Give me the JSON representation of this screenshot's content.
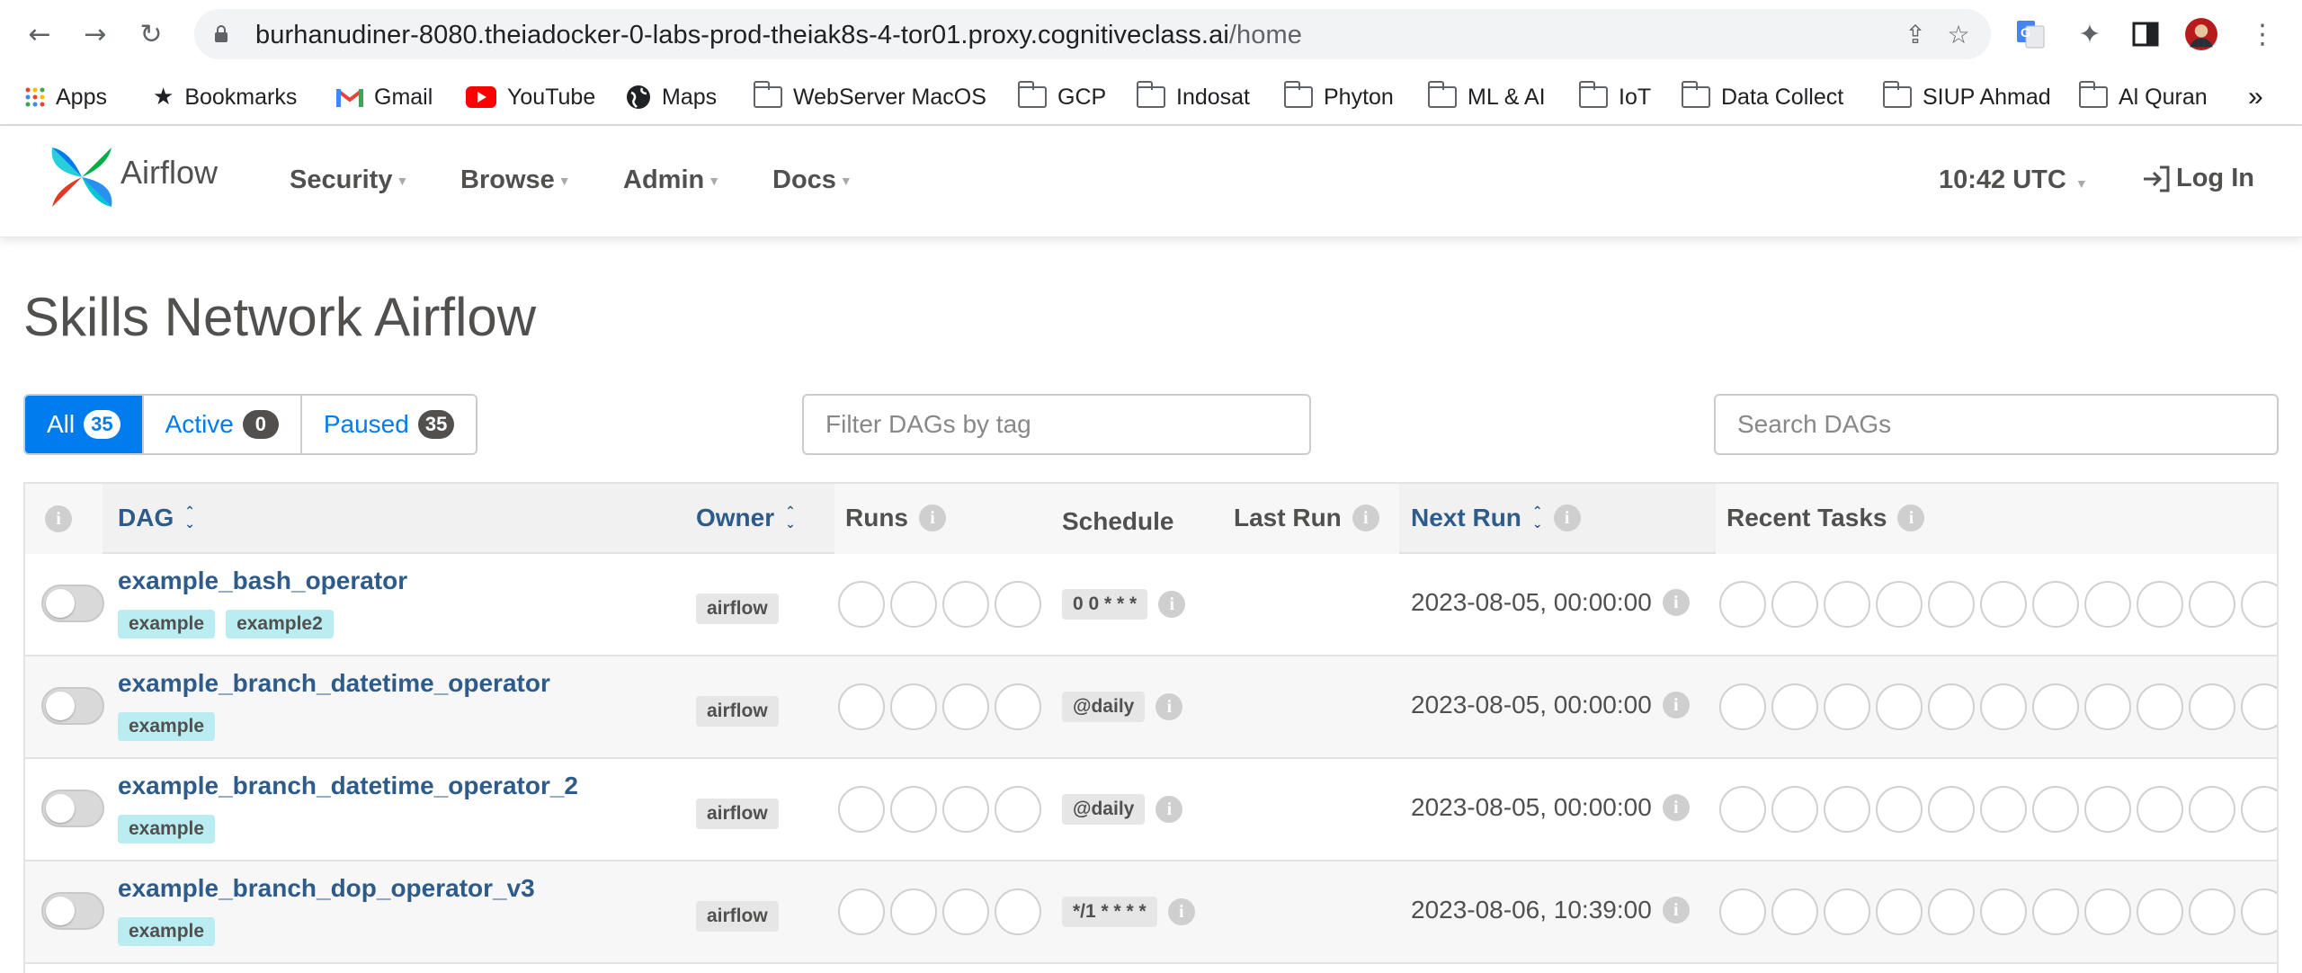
{
  "browser": {
    "url_host": "burhanudiner-8080.theiadocker-0-labs-prod-theiak8s-4-tor01.proxy.cognitiveclass.ai",
    "url_path": "/home",
    "bookmarks": [
      "Apps",
      "Bookmarks",
      "Gmail",
      "YouTube",
      "Maps",
      "WebServer MacOS",
      "GCP",
      "Indosat",
      "Phyton",
      "ML & AI",
      "IoT",
      "Data Collect",
      "SIUP Ahmad",
      "Al Quran"
    ],
    "more": "»"
  },
  "navbar": {
    "brand": "Airflow",
    "menus": [
      "Security",
      "Browse",
      "Admin",
      "Docs"
    ],
    "time": "10:42 UTC",
    "login": "Log In"
  },
  "page": {
    "title": "Skills Network Airflow",
    "filters": [
      {
        "label": "All",
        "count": "35"
      },
      {
        "label": "Active",
        "count": "0"
      },
      {
        "label": "Paused",
        "count": "35"
      }
    ],
    "tag_filter_placeholder": "Filter DAGs by tag",
    "search_placeholder": "Search DAGs"
  },
  "table": {
    "headers": {
      "dag": "DAG",
      "owner": "Owner",
      "runs": "Runs",
      "schedule": "Schedule",
      "last_run": "Last Run",
      "next_run": "Next Run",
      "recent_tasks": "Recent Tasks"
    },
    "rows": [
      {
        "name": "example_bash_operator",
        "tags": [
          "example",
          "example2"
        ],
        "owner": "airflow",
        "schedule": "0 0 * * *",
        "next_run": "2023-08-05, 00:00:00"
      },
      {
        "name": "example_branch_datetime_operator",
        "tags": [
          "example"
        ],
        "owner": "airflow",
        "schedule": "@daily",
        "next_run": "2023-08-05, 00:00:00"
      },
      {
        "name": "example_branch_datetime_operator_2",
        "tags": [
          "example"
        ],
        "owner": "airflow",
        "schedule": "@daily",
        "next_run": "2023-08-05, 00:00:00"
      },
      {
        "name": "example_branch_dop_operator_v3",
        "tags": [
          "example"
        ],
        "owner": "airflow",
        "schedule": "*/1 * * * *",
        "next_run": "2023-08-06, 10:39:00"
      }
    ]
  }
}
